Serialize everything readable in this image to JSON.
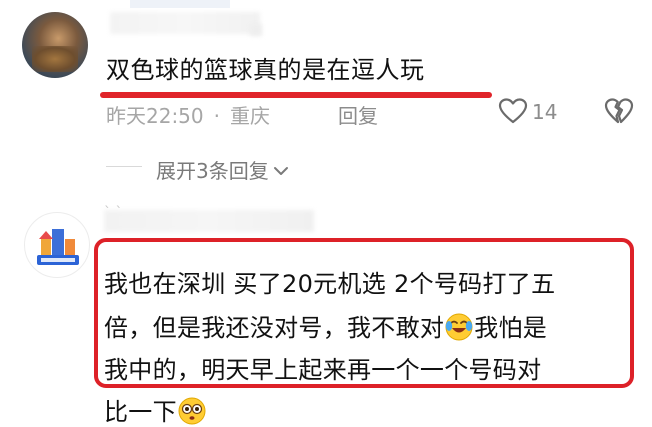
{
  "comment1": {
    "avatar_icon": "user-avatar-photo",
    "text": "双色球的篮球真的是在逗人玩",
    "time": "昨天22:50",
    "separator": "·",
    "location": "重庆",
    "reply_label": "回复",
    "like_count": "14",
    "like_icon": "heart-outline-icon",
    "dislike_icon": "broken-heart-icon",
    "highlight_color": "#e0242a"
  },
  "expand_replies": {
    "label": "展开3条回复"
  },
  "comment2": {
    "avatar_icon": "brand-logo-avatar",
    "line1": "我也在深圳 买了20元机选 2个号码打了五",
    "line2_before": "倍，但是我还没对号，我不敢对",
    "line2_after": "我怕是",
    "line3": "我中的，明天早上起来再一个一个号码对",
    "line4": "比一下",
    "emoji1": "laughing-crying-emoji",
    "emoji2": "wide-eyes-emoji",
    "highlight_color": "#dd2128"
  }
}
